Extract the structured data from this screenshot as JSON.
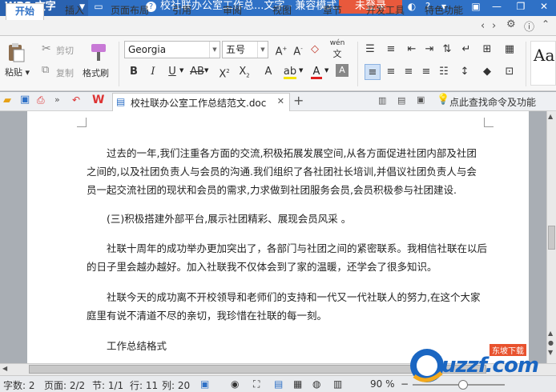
{
  "titlebar": {
    "app_name": "WPS 文字",
    "doc_title": "校社联办公室工作总...文字 - 兼容模式",
    "login": "未登录"
  },
  "tabs": [
    "开始",
    "插入",
    "页面布局",
    "引用",
    "审阅",
    "视图",
    "章节",
    "开发工具",
    "特色功能"
  ],
  "active_tab": "开始",
  "ribbon": {
    "paste": "粘贴",
    "cut": "剪切",
    "copy": "复制",
    "format_painter": "格式刷",
    "font_name": "Georgia",
    "font_size": "五号",
    "wen": "wén",
    "style_preview": "Aa"
  },
  "quick_access": {
    "doc_tab_label": "校社联办公室工作总结范文.doc",
    "search_hint": "点此查找命令及功能"
  },
  "document": {
    "paragraphs": [
      "过去的一年,我们注重各方面的交流,积极拓展发展空间,从各方面促进社团内部及社团",
      "之间的,以及社团负责人与会员的沟通.我们组织了各社团社长培训,并倡议社团负责人与会",
      "员一起交流社团的现状和会员的需求,力求做到社团服务会员,会员积极参与社团建设.",
      "(三)积极搭建外部平台,展示社团精彩、展现会员风采 。",
      "社联十周年的成功举办更加突出了，各部门与社团之间的紧密联系。我相信社联在以后",
      "的日子里会越办越好。加入社联我不仅体会到了家的温暖，还学会了很多知识。",
      "社联今天的成功离不开校领导和老师们的支持和一代又一代社联人的努力,在这个大家",
      "庭里有说不清道不尽的亲切，我珍惜在社联的每一刻。",
      "工作总结格式"
    ]
  },
  "statusbar": {
    "word_count": "字数: 2",
    "page": "页面: 2/2",
    "section": "节: 1/1",
    "row": "行: 11",
    "col": "列: 20",
    "zoom": "90 %"
  },
  "watermark": {
    "text": "uzzf.com",
    "tag": "东坡下载"
  }
}
